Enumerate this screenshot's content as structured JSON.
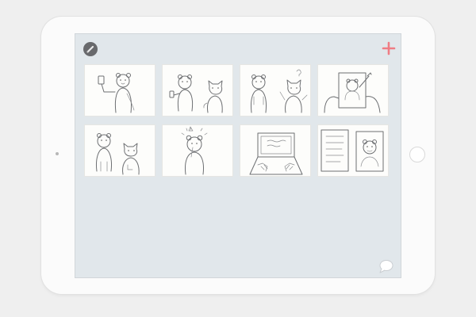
{
  "app": {
    "toolbar": {
      "edit_icon": "pencil-icon",
      "add_icon": "plus-icon",
      "add_color": "#ef7d84"
    },
    "footer": {
      "chat_icon": "speech-bubble-icon"
    },
    "storyboard": {
      "frames": [
        {
          "scene": "bear-selfie"
        },
        {
          "scene": "bear-phone-and-cat"
        },
        {
          "scene": "bear-and-cat-question"
        },
        {
          "scene": "bear-drawn-on-easel"
        },
        {
          "scene": "bear-and-cat-standing"
        },
        {
          "scene": "bear-exclamation"
        },
        {
          "scene": "laptop-typing"
        },
        {
          "scene": "two-panels-bear"
        }
      ]
    }
  }
}
